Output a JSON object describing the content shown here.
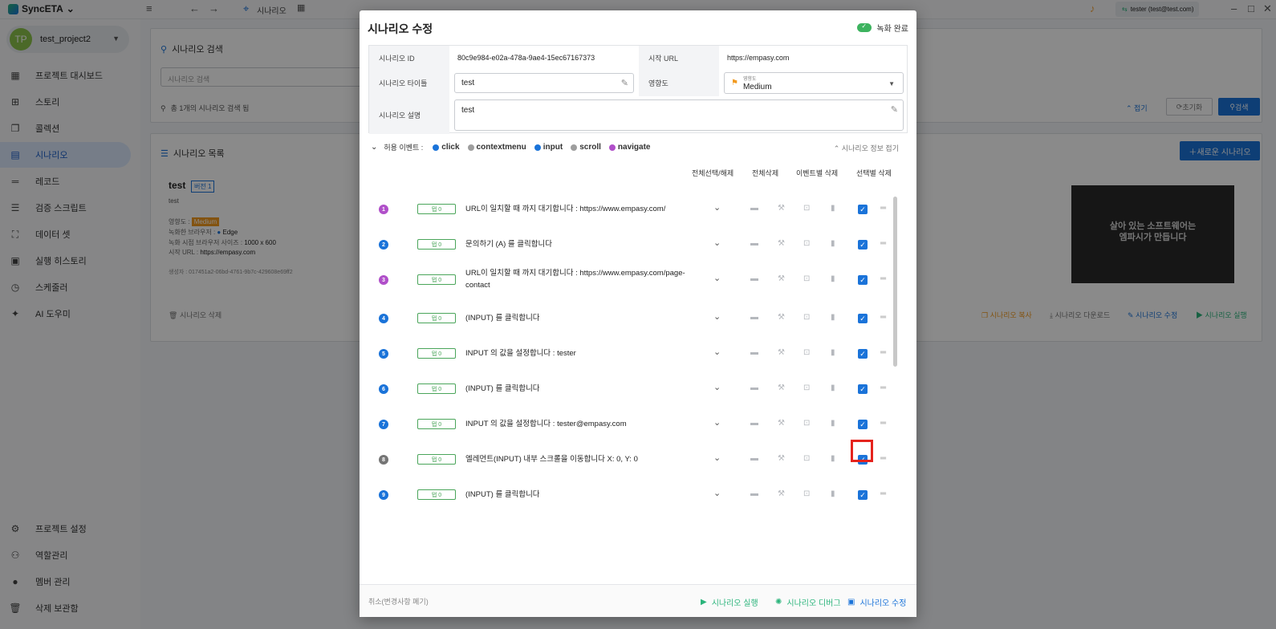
{
  "topbar": {
    "brand": "SyncETA",
    "breadcrumb": "시나리오",
    "user": "tester (test@test.com)"
  },
  "sidebar": {
    "project": "test_project2",
    "avatar": "TP",
    "items": [
      {
        "label": "프로젝트 대시보드"
      },
      {
        "label": "스토리"
      },
      {
        "label": "콜렉션"
      },
      {
        "label": "시나리오"
      },
      {
        "label": "레코드"
      },
      {
        "label": "검증 스크립트"
      },
      {
        "label": "데이터 셋"
      },
      {
        "label": "실행 히스토리"
      },
      {
        "label": "스케줄러"
      },
      {
        "label": "AI 도우미"
      }
    ],
    "bottom": [
      {
        "label": "프로젝트 설정"
      },
      {
        "label": "역할관리"
      },
      {
        "label": "멤버 관리"
      },
      {
        "label": "삭제 보관함"
      }
    ]
  },
  "background": {
    "search_title": "시나리오 검색",
    "search_placeholder": "시나리오 검색",
    "search_result": "총 1개의 시나리오 검색 됨",
    "fold": "접기",
    "reset": "초기화",
    "search_btn": "검색",
    "list_title": "시나리오 목록",
    "new_btn": "새로운 시나리오",
    "scenario_name": "test",
    "version": "버전 1",
    "scenario_desc": "test",
    "impact_label": "영향도 :",
    "impact_value": "Medium",
    "browser_label": "녹화한 브라우저 :",
    "browser_value": "Edge",
    "size_label": "녹화 시점 브라우저 사이즈 :",
    "size_value": "1000 x 600",
    "url_label": "시작 URL :",
    "url_value": "https://empasy.com",
    "creator": "생성자 : 017451a2-06bd-4761-9b7c-429608e69ff2",
    "delete": "시나리오 삭제",
    "copy": "시나리오 복사",
    "download": "시나리오 다운로드",
    "edit": "시나리오 수정",
    "run": "시나리오 실행",
    "thumb_text": "살아 있는 소프트웨어는\n엠파시가 만듭니다"
  },
  "modal": {
    "title": "시나리오 수정",
    "record_done": "녹화 완료",
    "id_label": "시나리오 ID",
    "id_value": "80c9e984-e02a-478a-9ae4-15ec67167373",
    "url_label": "시작 URL",
    "url_value": "https://empasy.com",
    "title_label": "시나리오 타이틀",
    "title_value": "test",
    "impact_label": "영향도",
    "impact_float": "영향도",
    "impact_value": "Medium",
    "desc_label": "시나리오 설명",
    "desc_value": "test",
    "allowed_label": "허용 이벤트 :",
    "events": [
      {
        "name": "click",
        "color": "#1a73d9"
      },
      {
        "name": "contextmenu",
        "color": "#9e9e9e"
      },
      {
        "name": "input",
        "color": "#1a73d9"
      },
      {
        "name": "scroll",
        "color": "#9e9e9e"
      },
      {
        "name": "navigate",
        "color": "#b04fc9"
      }
    ],
    "fold_info": "시나리오 정보 접기",
    "headers": {
      "select_all": "전체선택/해제",
      "delete_all": "전체삭제",
      "delete_by_event": "이벤트별 삭제",
      "delete_selected": "선택별 삭제"
    },
    "steps": [
      {
        "n": "1",
        "color": "#b04fc9",
        "tab": "탭 0",
        "text": "URL이 일치할 때 까지 대기합니다 : https://www.empasy.com/"
      },
      {
        "n": "2",
        "color": "#1a73d9",
        "tab": "탭 0",
        "text": "문의하기 (A) 를 클릭합니다"
      },
      {
        "n": "3",
        "color": "#b04fc9",
        "tab": "탭 0",
        "text": "URL이 일치할 때 까지 대기합니다 : https://www.empasy.com/page-contact"
      },
      {
        "n": "4",
        "color": "#1a73d9",
        "tab": "탭 0",
        "text": "(INPUT) 를 클릭합니다"
      },
      {
        "n": "5",
        "color": "#1a73d9",
        "tab": "탭 0",
        "text": "INPUT 의 값을 설정합니다 : tester"
      },
      {
        "n": "6",
        "color": "#1a73d9",
        "tab": "탭 0",
        "text": "(INPUT) 를 클릭합니다"
      },
      {
        "n": "7",
        "color": "#1a73d9",
        "tab": "탭 0",
        "text": "INPUT 의 값을 설정합니다 : tester@empasy.com"
      },
      {
        "n": "8",
        "color": "#757575",
        "tab": "탭 0",
        "text": "엘레먼트(INPUT) 내부 스크롤을 이동합니다 X: 0, Y: 0"
      },
      {
        "n": "9",
        "color": "#1a73d9",
        "tab": "탭 0",
        "text": "(INPUT) 를 클릭합니다"
      }
    ],
    "cancel": "취소(변경사항 폐기)",
    "run": "시나리오 실행",
    "debug": "시나리오 디버그",
    "save": "시나리오 수정"
  }
}
